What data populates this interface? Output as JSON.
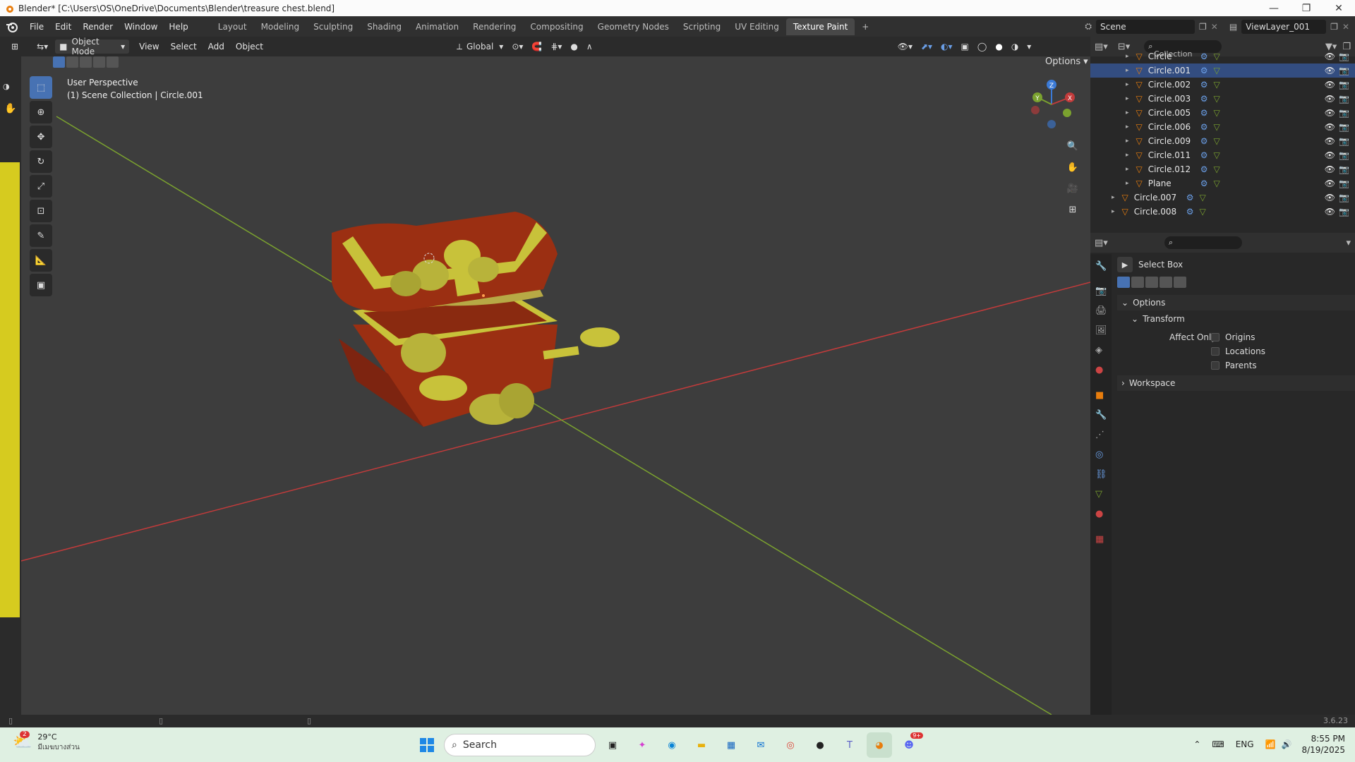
{
  "title_bar": {
    "title": "Blender* [C:\\Users\\OS\\OneDrive\\Documents\\Blender\\treasure chest.blend]"
  },
  "menu": [
    "File",
    "Edit",
    "Render",
    "Window",
    "Help"
  ],
  "workspace_tabs": [
    "Layout",
    "Modeling",
    "Sculpting",
    "Shading",
    "Animation",
    "Rendering",
    "Compositing",
    "Geometry Nodes",
    "Scripting",
    "UV Editing",
    "Texture Paint"
  ],
  "active_workspace": "Texture Paint",
  "scene": {
    "name": "Scene",
    "view_layer": "ViewLayer_001"
  },
  "header3d": {
    "mode": "Object Mode",
    "menus": [
      "View",
      "Select",
      "Add",
      "Object"
    ],
    "orientation": "Global",
    "options_label": "Options"
  },
  "viewport": {
    "perspective": "User Perspective",
    "collection_info": "(1) Scene Collection | Circle.001"
  },
  "gizmo": {
    "z": "Z",
    "y": "Y",
    "x": "X"
  },
  "outliner": {
    "collection_label": "Collection",
    "items": [
      {
        "name": "Circle"
      },
      {
        "name": "Circle.001"
      },
      {
        "name": "Circle.002"
      },
      {
        "name": "Circle.003"
      },
      {
        "name": "Circle.005"
      },
      {
        "name": "Circle.006"
      },
      {
        "name": "Circle.009"
      },
      {
        "name": "Circle.011"
      },
      {
        "name": "Circle.012"
      },
      {
        "name": "Plane"
      },
      {
        "name": "Circle.007"
      },
      {
        "name": "Circle.008"
      }
    ]
  },
  "properties": {
    "tool_name": "Select Box",
    "options_label": "Options",
    "transform_label": "Transform",
    "affect_only_label": "Affect Only",
    "checkboxes": [
      "Origins",
      "Locations",
      "Parents"
    ],
    "workspace_label": "Workspace"
  },
  "status": {
    "version": "3.6.23"
  },
  "taskbar": {
    "weather_temp": "29°C",
    "weather_desc": "มีเมฆบางส่วน",
    "weather_badge": "2",
    "search_placeholder": "Search",
    "lang": "ENG",
    "time": "8:55 PM",
    "date": "8/19/2025",
    "discord_badge": "9+"
  },
  "colors": {
    "accent": "#4772b3",
    "chest": "#9b2f12",
    "gold": "#c8c23a",
    "x_axis": "#c23b3b",
    "y_axis": "#7ba22f"
  }
}
